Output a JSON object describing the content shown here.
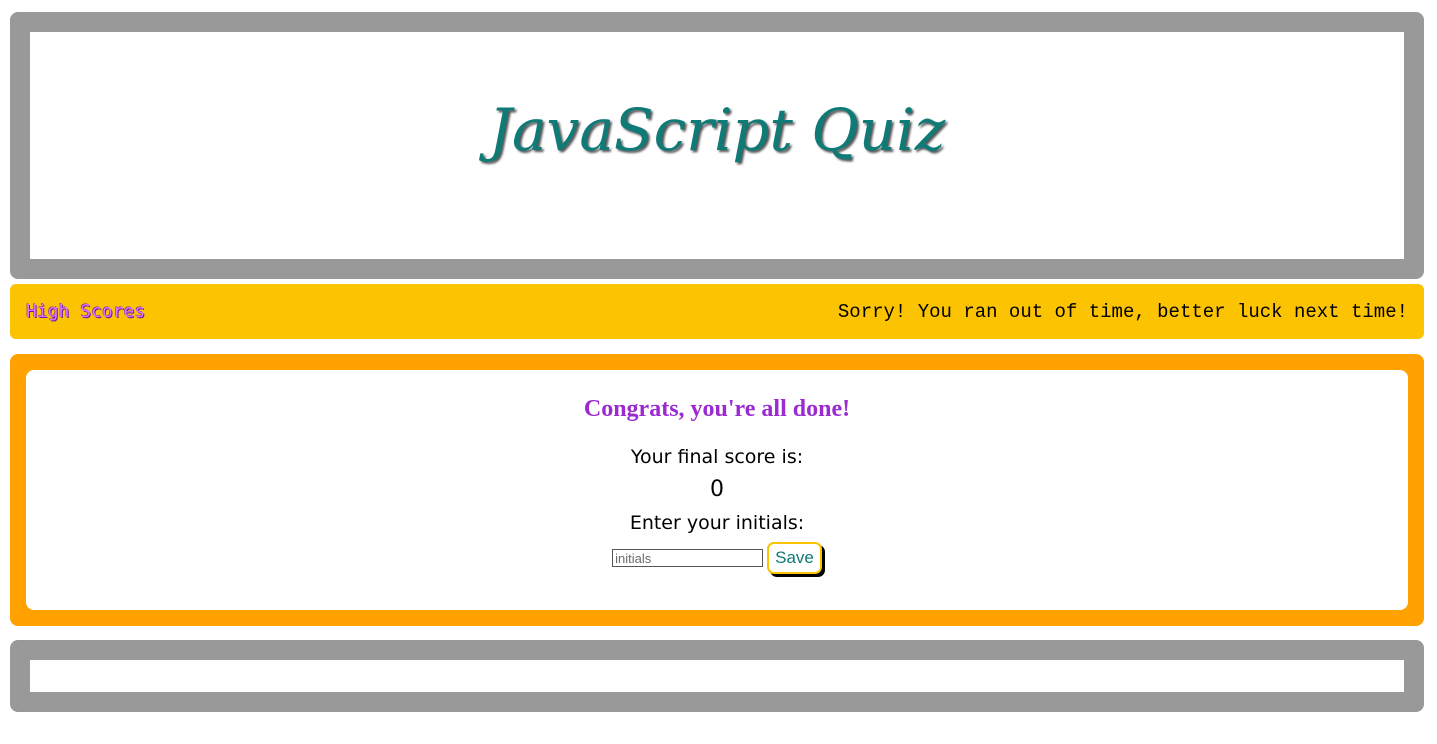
{
  "header": {
    "title": "JavaScript Quiz"
  },
  "nav": {
    "high_scores_label": "High Scores",
    "timer_message": "Sorry! You ran out of time, better luck next time!"
  },
  "quiz": {
    "done_heading": "Congrats, you're all done!",
    "score_label": "Your final score is:",
    "score_value": "0",
    "initials_label": "Enter your initials:",
    "initials_placeholder": "initials",
    "initials_value": "",
    "save_label": "Save"
  },
  "colors": {
    "title": "#0f7a76",
    "header_border": "#999999",
    "nav_background": "#fbc302",
    "high_scores_text": "#e074ff",
    "quiz_border": "#ffa200",
    "done_heading": "#9b2bd1"
  }
}
